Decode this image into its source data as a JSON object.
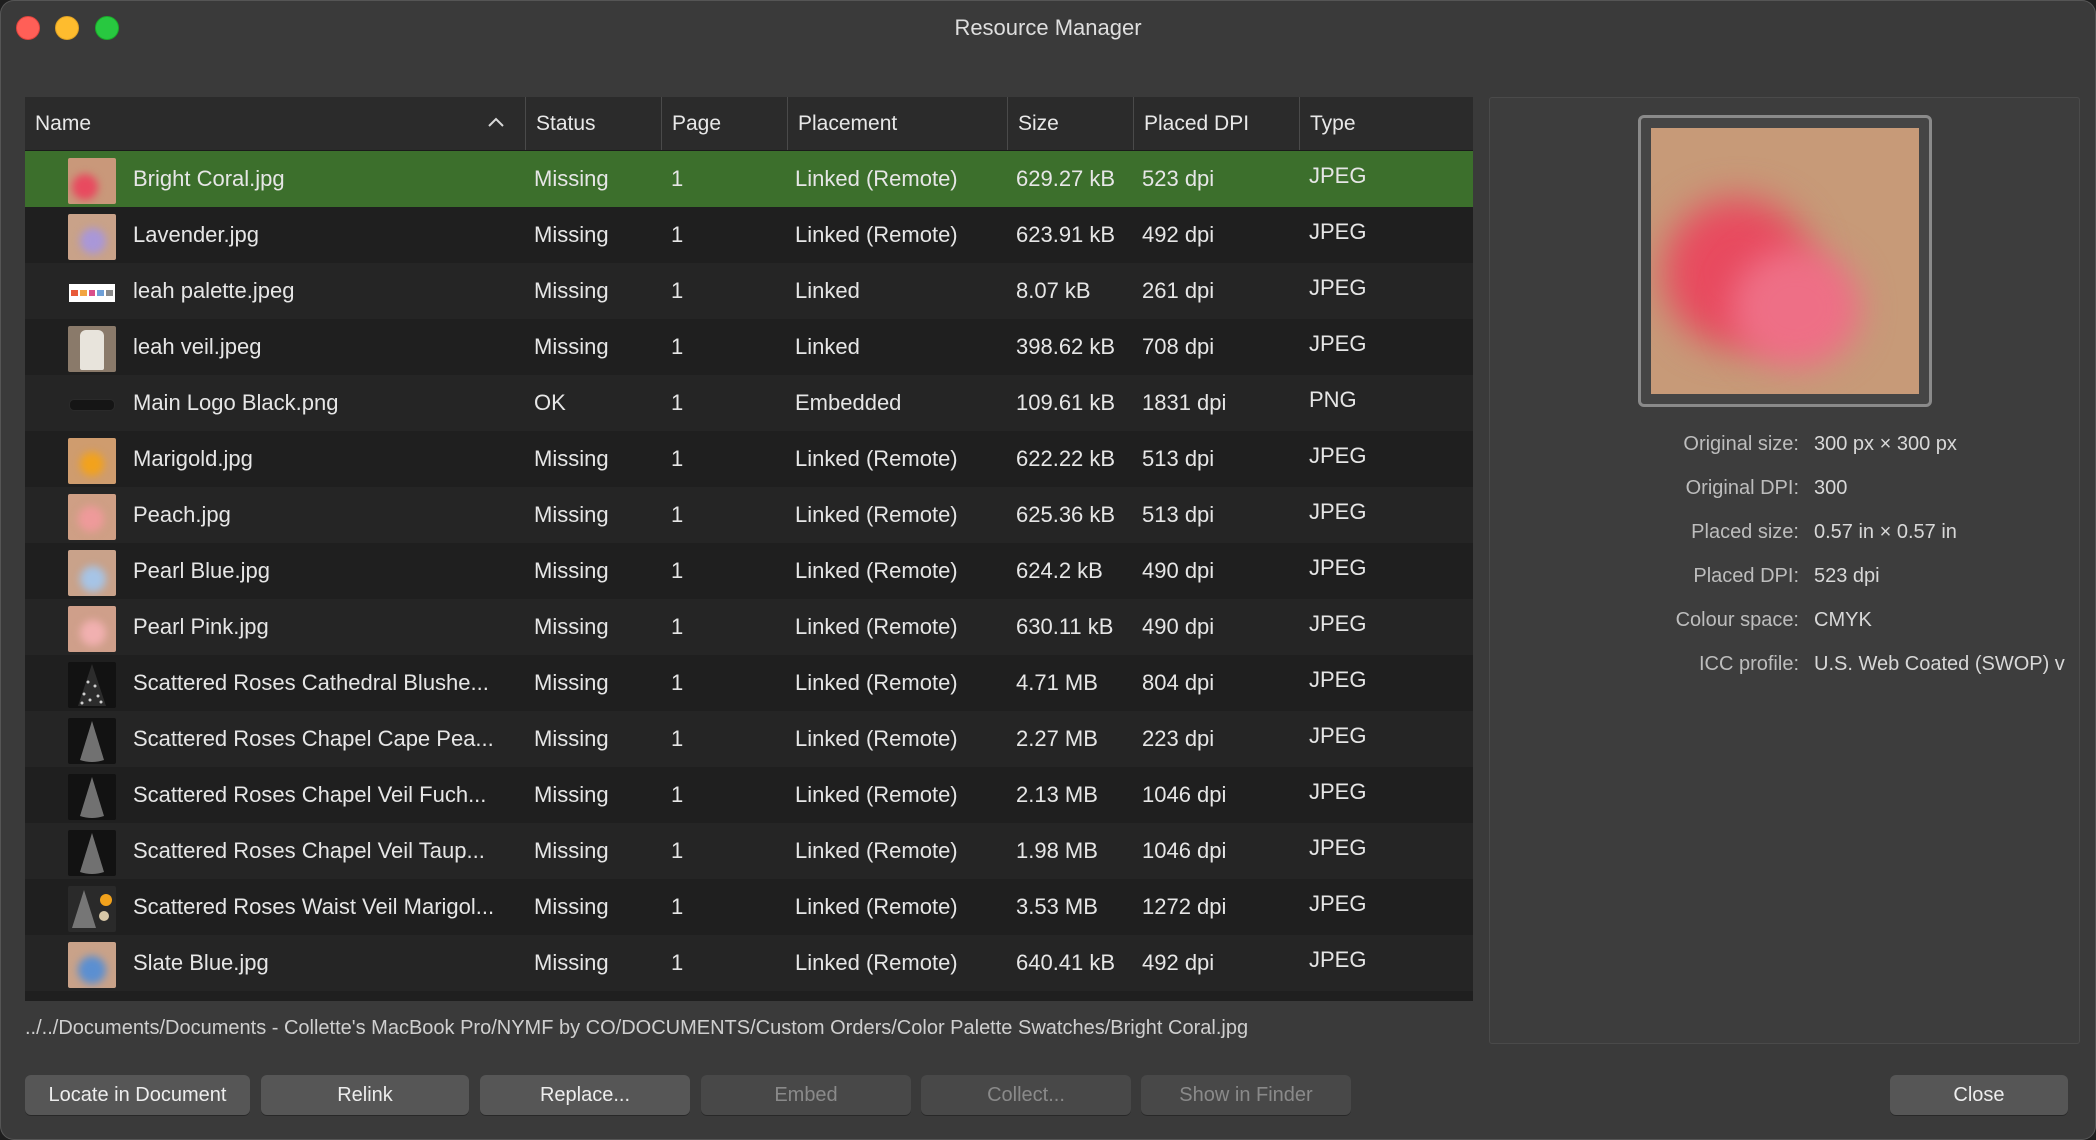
{
  "window": {
    "title": "Resource Manager"
  },
  "table": {
    "columns": [
      "Name",
      "Status",
      "Page",
      "Placement",
      "Size",
      "Placed DPI",
      "Type"
    ],
    "rows": [
      {
        "name": "Bright Coral.jpg",
        "status": "Missing",
        "page": "1",
        "placement": "Linked (Remote)",
        "size": "629.27 kB",
        "dpi": "523 dpi",
        "type": "JPEG",
        "thumb": "coral"
      },
      {
        "name": "Lavender.jpg",
        "status": "Missing",
        "page": "1",
        "placement": "Linked (Remote)",
        "size": "623.91 kB",
        "dpi": "492 dpi",
        "type": "JPEG",
        "thumb": "lavender"
      },
      {
        "name": "leah palette.jpeg",
        "status": "Missing",
        "page": "1",
        "placement": "Linked",
        "size": "8.07 kB",
        "dpi": "261 dpi",
        "type": "JPEG",
        "thumb": "palette"
      },
      {
        "name": "leah veil.jpeg",
        "status": "Missing",
        "page": "1",
        "placement": "Linked",
        "size": "398.62 kB",
        "dpi": "708 dpi",
        "type": "JPEG",
        "thumb": "veil"
      },
      {
        "name": "Main Logo Black.png",
        "status": "OK",
        "page": "1",
        "placement": "Embedded",
        "size": "109.61 kB",
        "dpi": "1831 dpi",
        "type": "PNG",
        "thumb": "logo"
      },
      {
        "name": "Marigold.jpg",
        "status": "Missing",
        "page": "1",
        "placement": "Linked (Remote)",
        "size": "622.22 kB",
        "dpi": "513 dpi",
        "type": "JPEG",
        "thumb": "marigold"
      },
      {
        "name": "Peach.jpg",
        "status": "Missing",
        "page": "1",
        "placement": "Linked (Remote)",
        "size": "625.36 kB",
        "dpi": "513 dpi",
        "type": "JPEG",
        "thumb": "peach"
      },
      {
        "name": "Pearl Blue.jpg",
        "status": "Missing",
        "page": "1",
        "placement": "Linked (Remote)",
        "size": "624.2 kB",
        "dpi": "490 dpi",
        "type": "JPEG",
        "thumb": "pearlblue"
      },
      {
        "name": "Pearl Pink.jpg",
        "status": "Missing",
        "page": "1",
        "placement": "Linked (Remote)",
        "size": "630.11 kB",
        "dpi": "490 dpi",
        "type": "JPEG",
        "thumb": "pearlpink"
      },
      {
        "name": "Scattered Roses Cathedral Blushe...",
        "status": "Missing",
        "page": "1",
        "placement": "Linked (Remote)",
        "size": "4.71 MB",
        "dpi": "804 dpi",
        "type": "JPEG",
        "thumb": "cathedral"
      },
      {
        "name": "Scattered Roses Chapel Cape Pea...",
        "status": "Missing",
        "page": "1",
        "placement": "Linked (Remote)",
        "size": "2.27 MB",
        "dpi": "223 dpi",
        "type": "JPEG",
        "thumb": "chapel"
      },
      {
        "name": "Scattered Roses Chapel Veil Fuch...",
        "status": "Missing",
        "page": "1",
        "placement": "Linked (Remote)",
        "size": "2.13 MB",
        "dpi": "1046 dpi",
        "type": "JPEG",
        "thumb": "chapel"
      },
      {
        "name": "Scattered Roses Chapel Veil Taup...",
        "status": "Missing",
        "page": "1",
        "placement": "Linked (Remote)",
        "size": "1.98 MB",
        "dpi": "1046 dpi",
        "type": "JPEG",
        "thumb": "chapel"
      },
      {
        "name": "Scattered Roses Waist Veil Marigol...",
        "status": "Missing",
        "page": "1",
        "placement": "Linked (Remote)",
        "size": "3.53 MB",
        "dpi": "1272 dpi",
        "type": "JPEG",
        "thumb": "waist"
      },
      {
        "name": "Slate Blue.jpg",
        "status": "Missing",
        "page": "1",
        "placement": "Linked (Remote)",
        "size": "640.41 kB",
        "dpi": "492 dpi",
        "type": "JPEG",
        "thumb": "slateblue"
      }
    ],
    "selected_index": 0
  },
  "details": {
    "original_size_label": "Original size:",
    "original_size": "300 px × 300 px",
    "original_dpi_label": "Original DPI:",
    "original_dpi": "300",
    "placed_size_label": "Placed size:",
    "placed_size": "0.57 in × 0.57 in",
    "placed_dpi_label": "Placed DPI:",
    "placed_dpi": "523 dpi",
    "colour_space_label": "Colour space:",
    "colour_space": "CMYK",
    "icc_profile_label": "ICC profile:",
    "icc_profile": "U.S. Web Coated (SWOP) v"
  },
  "path": "../../Documents/Documents - Collette's MacBook Pro/NYMF by CO/DOCUMENTS/Custom Orders/Color Palette Swatches/Bright Coral.jpg",
  "buttons": {
    "locate": "Locate in Document",
    "relink": "Relink",
    "replace": "Replace...",
    "embed": "Embed",
    "collect": "Collect...",
    "show_in_finder": "Show in Finder",
    "close": "Close"
  },
  "colors": {
    "selection": "#3c6f2c",
    "window_bg": "#3a3a3a",
    "table_bg": "#1f1f1f"
  }
}
